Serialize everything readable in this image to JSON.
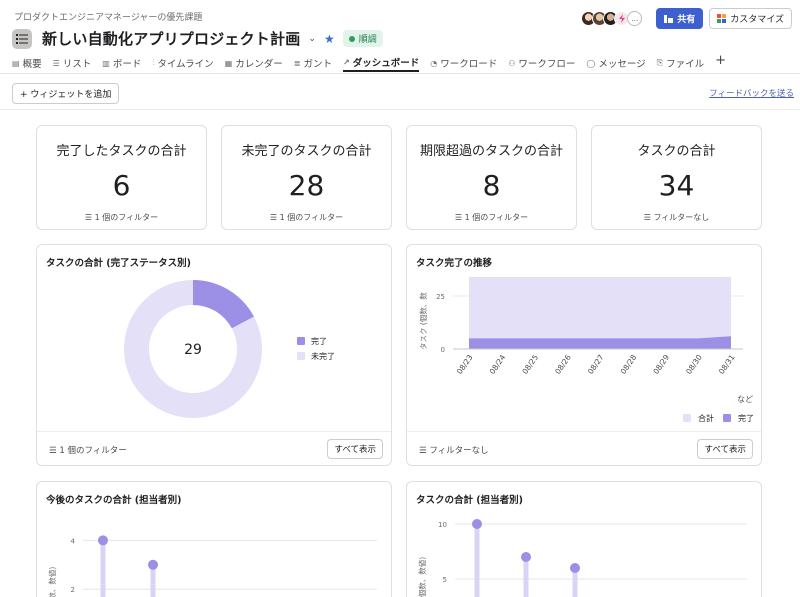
{
  "header": {
    "breadcrumb": "プロダクトエンジニアマネージャーの優先課題",
    "title": "新しい自動化アプリプロジェクト計画",
    "status": "順調",
    "share_label": "共有",
    "customize_label": "カスタマイズ",
    "more_avatars": "…"
  },
  "tabs": [
    {
      "label": "概要",
      "icon": "overview-icon"
    },
    {
      "label": "リスト",
      "icon": "list-icon"
    },
    {
      "label": "ボード",
      "icon": "board-icon"
    },
    {
      "label": "タイムライン",
      "icon": "timeline-icon"
    },
    {
      "label": "カレンダー",
      "icon": "calendar-icon"
    },
    {
      "label": "ガント",
      "icon": "gantt-icon"
    },
    {
      "label": "ダッシュボード",
      "icon": "dashboard-icon",
      "active": true
    },
    {
      "label": "ワークロード",
      "icon": "workload-icon"
    },
    {
      "label": "ワークフロー",
      "icon": "workflow-icon"
    },
    {
      "label": "メッセージ",
      "icon": "message-icon"
    },
    {
      "label": "ファイル",
      "icon": "file-icon"
    }
  ],
  "toolbar": {
    "add_widget": "+ ウィジェットを追加",
    "feedback": "フィードバックを送る"
  },
  "stats": [
    {
      "label": "完了したタスクの合計",
      "value": "6",
      "filter": "1 個のフィルター"
    },
    {
      "label": "未完了のタスクの合計",
      "value": "28",
      "filter": "1 個のフィルター"
    },
    {
      "label": "期限超過のタスクの合計",
      "value": "8",
      "filter": "1 個のフィルター"
    },
    {
      "label": "タスクの合計",
      "value": "34",
      "filter": "フィルターなし"
    }
  ],
  "colors": {
    "accent": "#3d5fd0",
    "done": "#9b8fe6",
    "not_done": "#e4e0f7",
    "status_green": "#2f9e5e"
  },
  "chart_data": [
    {
      "type": "pie",
      "title": "タスクの合計 (完了ステータス別)",
      "center_label": "29",
      "slices": [
        {
          "name": "完了",
          "value": 5
        },
        {
          "name": "未完了",
          "value": 24
        }
      ],
      "legend_position": "right",
      "footer_filter": "1 個のフィルター",
      "footer_button": "すべて表示"
    },
    {
      "type": "area",
      "title": "タスク完了の推移",
      "ylabel": "タスク (個数、数",
      "x": [
        "08/23",
        "08/24",
        "08/25",
        "08/26",
        "08/27",
        "08/28",
        "08/29",
        "08/30",
        "08/31"
      ],
      "yticks": [
        0,
        25
      ],
      "ylim": [
        0,
        34
      ],
      "series": [
        {
          "name": "合計",
          "values": [
            34,
            34,
            34,
            34,
            34,
            34,
            34,
            34,
            34
          ]
        },
        {
          "name": "完了",
          "values": [
            5,
            5,
            5,
            5,
            5,
            5,
            5,
            5,
            6
          ]
        }
      ],
      "more_label": "など",
      "legend_position": "bottom-right",
      "footer_filter": "フィルターなし",
      "footer_button": "すべて表示"
    },
    {
      "type": "bar",
      "title": "今後のタスクの合計 (担当者別)",
      "ylabel": "(個数、数値)",
      "yticks": [
        2,
        4
      ],
      "ylim": [
        0,
        5
      ],
      "values": [
        4,
        3
      ]
    },
    {
      "type": "bar",
      "title": "タスクの合計 (担当者別)",
      "ylabel": "ク (個数、数値)",
      "yticks": [
        5,
        10
      ],
      "ylim": [
        0,
        12
      ],
      "values": [
        10,
        7,
        6
      ]
    }
  ]
}
